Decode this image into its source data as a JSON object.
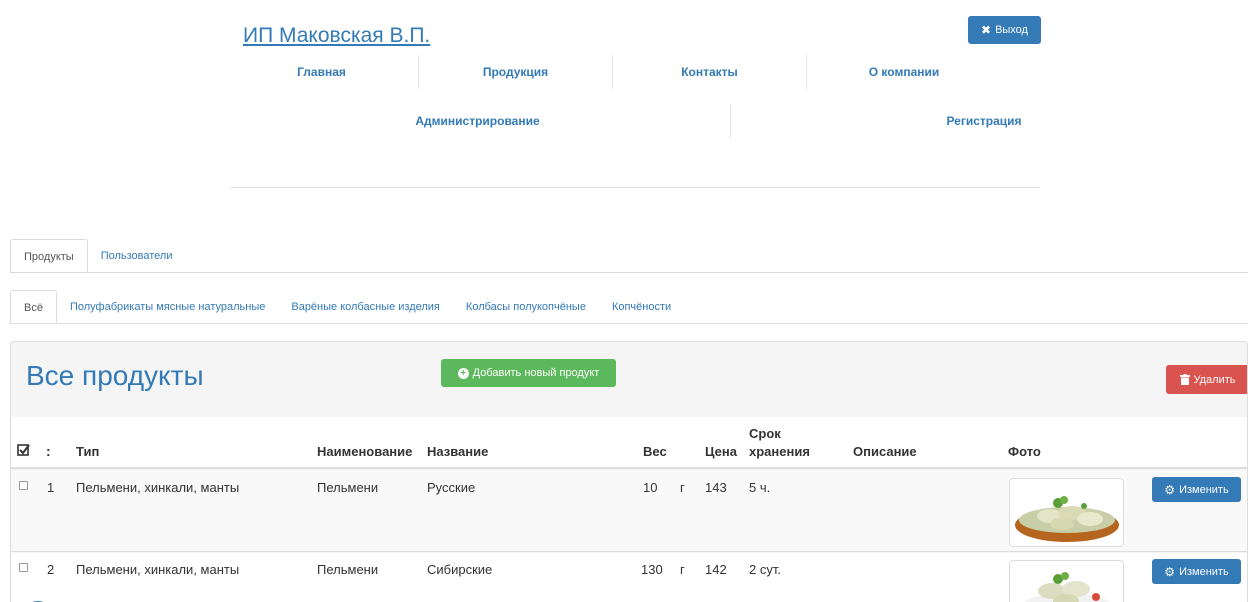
{
  "header": {
    "brand": "ИП Маковская В.П.",
    "logout_label": "Выход",
    "nav_primary": [
      "Главная",
      "Продукция",
      "Контакты",
      "О компании"
    ],
    "nav_secondary": [
      "Администрирование",
      "Регистрация"
    ]
  },
  "tabs": {
    "top": [
      "Продукты",
      "Пользователи"
    ],
    "categories": [
      "Всё",
      "Полуфабрикаты мясные натуральные",
      "Варёные колбасные изделия",
      "Колбасы полукопчёные",
      "Копчёности"
    ]
  },
  "panel": {
    "title": "Все продукты",
    "add_label": "Добавить новый продукт",
    "delete_label": "Удалить"
  },
  "table": {
    "headers": {
      "num": ":",
      "type": "Тип",
      "name": "Наименование",
      "title": "Название",
      "weight": "Вес",
      "price": "Цена",
      "shelf_1": "Срок",
      "shelf_2": "хранения",
      "description": "Описание",
      "photo": "Фото"
    },
    "edit_label": "Изменить",
    "rows": [
      {
        "num": "1",
        "type": "Пельмени, хинкали, манты",
        "name": "Пельмени",
        "title": "Русские",
        "weight": "10",
        "unit": "г",
        "price": "143",
        "shelf": "5 ч.",
        "description": ""
      },
      {
        "num": "2",
        "type": "Пельмени, хинкали, манты",
        "name": "Пельмени",
        "title": "Сибирские",
        "weight": "130",
        "unit": "г",
        "price": "142",
        "shelf": "2 сут.",
        "description": ""
      }
    ]
  },
  "colors": {
    "primary": "#337ab7",
    "success": "#5cb85c",
    "danger": "#d9534f"
  }
}
